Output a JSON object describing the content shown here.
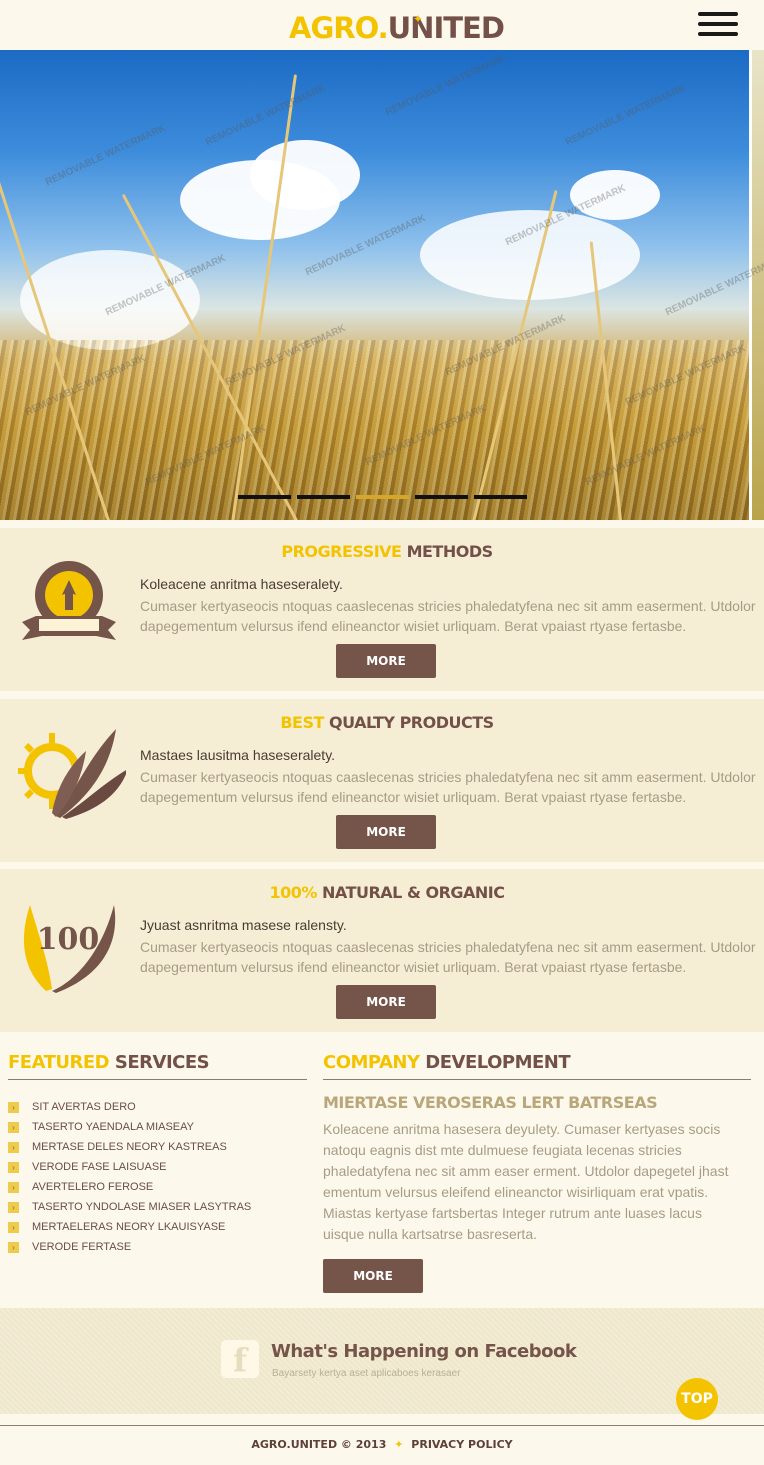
{
  "header": {
    "logo_part1": "AGRO.",
    "logo_part2": "UNITED",
    "menu_icon": "hamburger-menu-icon"
  },
  "hero": {
    "watermark": "REMOVABLE WATERMARK",
    "slides_count": 5,
    "active_slide": 3
  },
  "features": [
    {
      "title_highlight": "PROGRESSIVE",
      "title_rest": "METHODS",
      "icon": "windmill-badge-icon",
      "heading": "Koleacene anritma haseseralety.",
      "body": "Cumaser kertyaseocis ntoquas caaslecenas stricies phaledatyfena nec sit amm easerment. Utdolor dapegementum velursus ifend elineanctor wisiet urliquam. Berat vpaiast rtyase fertasbe.",
      "button": "MORE"
    },
    {
      "title_highlight": "BEST",
      "title_rest": "QUALTY PRODUCTS",
      "icon": "sun-wheat-icon",
      "heading": "Mastaes lausitma haseseralety.",
      "body": "Cumaser kertyaseocis ntoquas caaslecenas stricies phaledatyfena nec sit amm easerment. Utdolor dapegementum velursus ifend elineanctor wisiet urliquam. Berat vpaiast rtyase fertasbe.",
      "button": "MORE"
    },
    {
      "title_highlight": "100%",
      "title_rest": "NATURAL & ORGANIC",
      "icon": "wheat-100-icon",
      "icon_text": "100",
      "heading": "Jyuast asnritma masese ralensty.",
      "body": "Cumaser kertyaseocis ntoquas caaslecenas stricies phaledatyfena nec sit amm easerment. Utdolor dapegementum velursus ifend elineanctor wisiet urliquam. Berat vpaiast rtyase fertasbe.",
      "button": "MORE"
    }
  ],
  "services": {
    "title_highlight": "FEATURED",
    "title_rest": "SERVICES",
    "items": [
      "SIT AVERTAS DERO",
      "TASERTO YAENDALA MIASEAY",
      "MERTASE DELES NEORY KASTREAS",
      "VERODE FASE LAISUASE",
      "AVERTELERO FEROSE",
      "TASERTO YNDOLASE MIASER LASYTRAS",
      "MERTAELERAS NEORY LKAUISYASE",
      "VERODE FERTASE"
    ]
  },
  "development": {
    "title_highlight": "COMPANY",
    "title_rest": "DEVELOPMENT",
    "subtitle": "MIERTASE VEROSERAS LERT BATRSEAS",
    "body": "Koleacene anritma hasesera deyulety. Cumaser kertyases socis natoqu eagnis dist mte dulmuese feugiata lecenas stricies phaledatyfena nec sit amm easer erment. Utdolor dapegetel jhast ementum velursus eleifend elineanctor wisirliquam erat vpatis. Miastas kertyase fartsbertas Integer rutrum ante luases lacus uisque nulla kartsatrse basreserta.",
    "button": "MORE"
  },
  "facebook": {
    "icon": "facebook-icon",
    "title": "What's Happening on Facebook",
    "subtitle": "Bayarsety kertya aset aplicaboes kerasaer"
  },
  "top_button": "TOP",
  "footer": {
    "brand": "AGRO.UNITED",
    "copyright": "© 2013",
    "privacy": "PRIVACY POLICY"
  },
  "colors": {
    "accent": "#f4c300",
    "brand_dark": "#735148",
    "button": "#755449",
    "panel": "#f5eed5"
  }
}
